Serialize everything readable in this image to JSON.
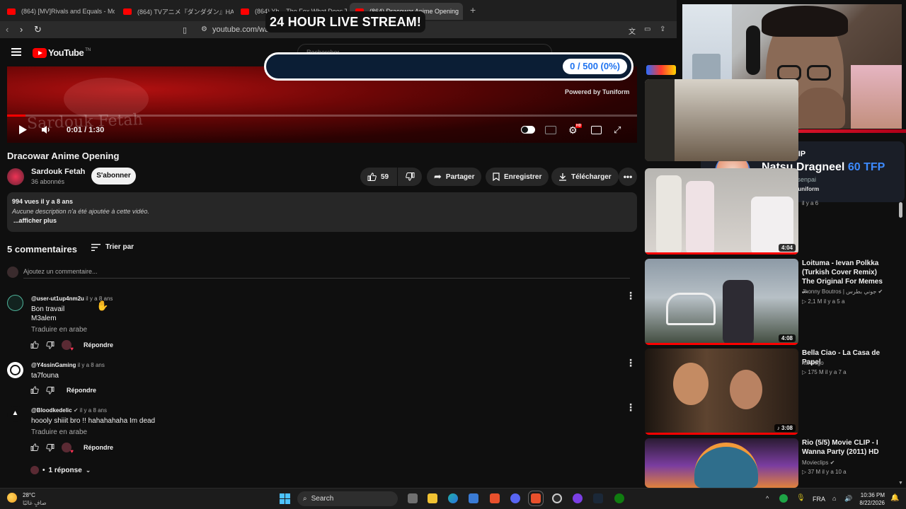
{
  "browser": {
    "tabs": [
      {
        "label": "(864) [MV]Rivals and Equals - Mori C"
      },
      {
        "label": "(864) TVアニメ『ダンダダン』HAYASii「Hun"
      },
      {
        "label": "(864) Yb... The Fox What Does The"
      },
      {
        "label": "(864) Dracowar Anime Opening"
      }
    ],
    "url": "youtube.com/wat"
  },
  "stream": {
    "title": "24 HOUR LIVE STREAM!",
    "goal": "0 / 500 (0%)",
    "powered_by": "Powered by Tuniform",
    "tip_heading": "LATEST TIP",
    "tip_name": "Natsu Dragneel",
    "tip_amount": "60 TFP",
    "tip_kick": "Kick: Natsu_senpai",
    "tip_powered": "Powered by Tuniform"
  },
  "header": {
    "logo": "YouTube",
    "logo_sup": "TN",
    "search_placeholder": "Rechercher"
  },
  "player": {
    "time": "0:01 / 1:30",
    "progress_fraction": 0.011,
    "watermark": "Sardouk Fetah"
  },
  "video": {
    "title": "Dracowar Anime Opening",
    "channel": "Sardouk Fetah",
    "subscribers": "36 abonnés",
    "subscribe_label": "S'abonner",
    "likes": "59",
    "share_label": "Partager",
    "save_label": "Enregistrer",
    "download_label": "Télécharger",
    "views_date": "994 vues  il y a 8 ans",
    "description": "Aucune description n'a été ajoutée à cette vidéo.",
    "show_more": "...afficher plus"
  },
  "comments": {
    "count_label": "5 commentaires",
    "sort_label": "Trier par",
    "add_placeholder": "Ajoutez un commentaire...",
    "items": [
      {
        "author": "@user-ut1up4nm2u",
        "date": "il y a 8 ans",
        "lines": [
          "Bon travail",
          "M3alem"
        ],
        "translate": "Traduire en arabe",
        "reply": "Répondre"
      },
      {
        "author": "@Y4ssinGaming",
        "date": "il y a 8 ans",
        "lines": [
          "ta7founa"
        ],
        "translate": "",
        "reply": "Répondre"
      },
      {
        "author": "@Bloodkedelic",
        "date": "il y a 8 ans",
        "lines": [
          "hoooly shiiit bro !! hahahahaha Im dead"
        ],
        "translate": "Traduire en arabe",
        "reply": "Répondre"
      }
    ],
    "replies_label": "1 réponse"
  },
  "sidebar": {
    "items": [
      {
        "duration": "4:04",
        "title": "",
        "channel": "",
        "meta": "il y a 6"
      },
      {
        "duration": "4:08",
        "title": "Loituma - Ievan Polkka (Turkish Cover Remix) The Original For Memes ...",
        "channel": "Jhonny Boutros | جوني بطرس",
        "meta": "2,1 M  il y a 5 a"
      },
      {
        "duration": "3:08",
        "title": "Bella Ciao - La Casa de Papel",
        "channel": "harisego",
        "meta": "175 M  il y a 7 a"
      },
      {
        "duration": "",
        "title": "Rio (5/5) Movie CLIP - I Wanna Party (2011) HD",
        "channel": "Movieclips",
        "meta": "37 M  il y a 10 a"
      }
    ]
  },
  "taskbar": {
    "weather_temp": "28°C",
    "weather_desc": "صافٍ غالبًا",
    "search_label": "Search",
    "language": "FRA",
    "time": "10:36 PM",
    "date": "8/22/2026"
  }
}
